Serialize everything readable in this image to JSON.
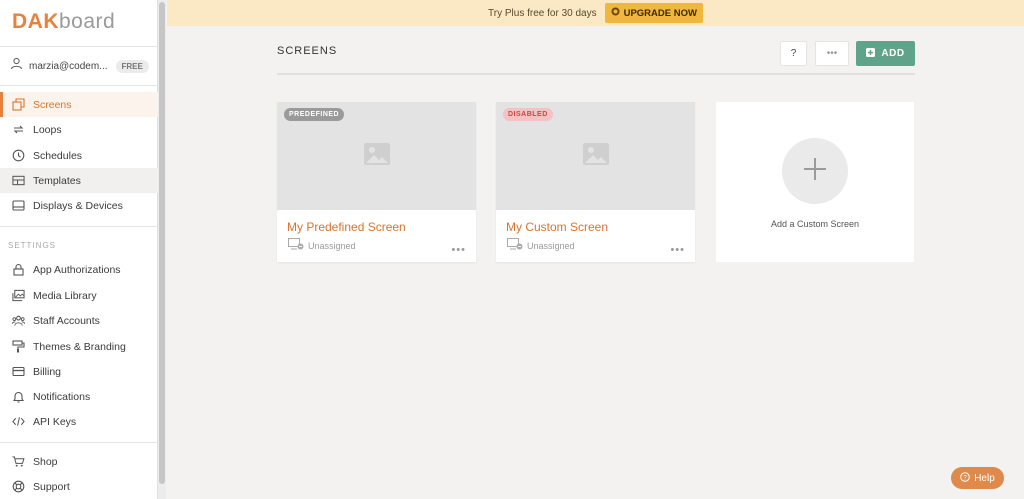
{
  "logo": {
    "prefix": "DAK",
    "suffix": "board"
  },
  "user": {
    "email": "marzia@codem...",
    "plan_badge": "FREE"
  },
  "nav": {
    "main": [
      {
        "label": "Screens",
        "icon": "screens-icon"
      },
      {
        "label": "Loops",
        "icon": "loop-icon"
      },
      {
        "label": "Schedules",
        "icon": "clock-icon"
      },
      {
        "label": "Templates",
        "icon": "templates-icon"
      },
      {
        "label": "Displays & Devices",
        "icon": "display-icon"
      }
    ],
    "settings_heading": "SETTINGS",
    "settings": [
      {
        "label": "App Authorizations",
        "icon": "lock-icon"
      },
      {
        "label": "Media Library",
        "icon": "images-icon"
      },
      {
        "label": "Staff Accounts",
        "icon": "users-icon"
      },
      {
        "label": "Themes & Branding",
        "icon": "paint-roller-icon"
      },
      {
        "label": "Billing",
        "icon": "credit-card-icon"
      },
      {
        "label": "Notifications",
        "icon": "bell-icon"
      },
      {
        "label": "API Keys",
        "icon": "code-icon"
      }
    ],
    "bottom": [
      {
        "label": "Shop",
        "icon": "cart-icon"
      },
      {
        "label": "Support",
        "icon": "lifebuoy-icon"
      }
    ]
  },
  "banner": {
    "text": "Try Plus free for 30 days",
    "upgrade_label": "UPGRADE NOW"
  },
  "page": {
    "title": "SCREENS",
    "help_label": "?",
    "more_label": "•••",
    "add_label": "ADD"
  },
  "cards": [
    {
      "badge": "PREDEFINED",
      "title": "My Predefined Screen",
      "status": "Unassigned",
      "menu": "•••"
    },
    {
      "badge": "DISABLED",
      "title": "My Custom Screen",
      "status": "Unassigned",
      "menu": "•••"
    }
  ],
  "add_card": {
    "label": "Add a Custom Screen"
  },
  "help_widget": {
    "label": "Help"
  },
  "colors": {
    "accent": "#e8823b",
    "add_button": "#5fa48a",
    "banner_bg": "#fbe9c5",
    "upgrade_bg": "#f0b63d",
    "disabled_badge": "#f3c2c2"
  }
}
